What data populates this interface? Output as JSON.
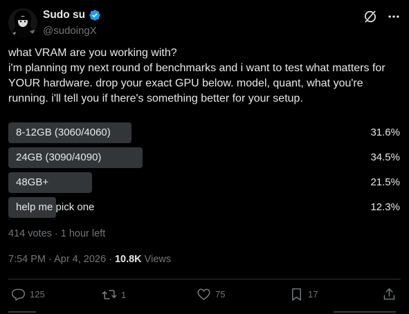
{
  "author": {
    "display_name": "Sudo su",
    "handle": "@sudoingX",
    "verified": true
  },
  "tweet": {
    "text": "what VRAM are you working with?\ni'm planning my next round of benchmarks and i want to test what matters for YOUR hardware. drop your exact GPU below. model, quant, what you're running. i'll tell you if there's something better for your setup."
  },
  "poll": {
    "options": [
      {
        "label": "8-12GB (3060/4060)",
        "percent": "31.6%",
        "fraction": 0.316
      },
      {
        "label": "24GB (3090/4090)",
        "percent": "34.5%",
        "fraction": 0.345
      },
      {
        "label": "48GB+",
        "percent": "21.5%",
        "fraction": 0.215
      },
      {
        "label": "help me pick one",
        "percent": "12.3%",
        "fraction": 0.123
      }
    ],
    "meta": "414 votes · 1 hour left"
  },
  "timestamp": {
    "time": "7:54 PM · Apr 4, 2026 · ",
    "views_count": "10.8K",
    "views_label": " Views"
  },
  "actions": {
    "replies": "125",
    "reposts": "1",
    "likes": "75",
    "bookmarks": "17"
  },
  "colors": {
    "background": "#000000",
    "text": "#e7e9ea",
    "muted": "#71767b",
    "poll_bar": "#333639",
    "verified": "#1d9bf0"
  }
}
